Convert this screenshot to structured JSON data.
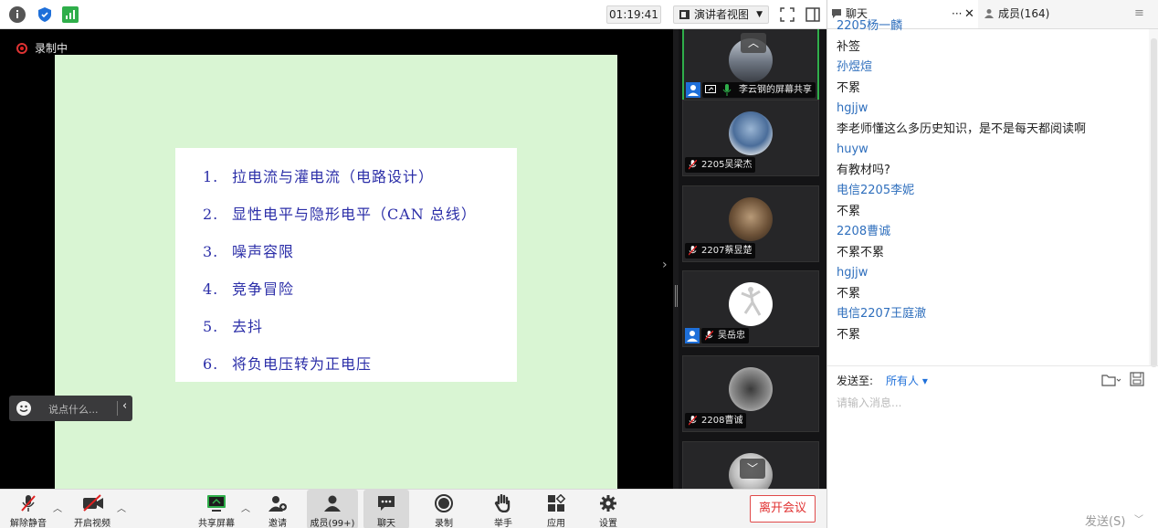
{
  "topbar": {
    "timer": "01:19:41",
    "view_label": "演讲者视图"
  },
  "stage": {
    "recording_label": "录制中",
    "slide_items": [
      {
        "num": "1.",
        "text": "拉电流与灌电流（电路设计）"
      },
      {
        "num": "2.",
        "text": "显性电平与隐形电平（CAN 总线）"
      },
      {
        "num": "3.",
        "text": "噪声容限"
      },
      {
        "num": "4.",
        "text": "竞争冒险"
      },
      {
        "num": "5.",
        "text": "去抖"
      },
      {
        "num": "6.",
        "text": "将负电压转为正电压"
      }
    ],
    "chat_placeholder": "说点什么..."
  },
  "gallery": {
    "tiles": [
      {
        "label": "李云钢的屏幕共享",
        "host": true
      },
      {
        "label": "2205吴梁杰",
        "host": false
      },
      {
        "label": "2207蔡昱楚",
        "host": false
      },
      {
        "label": "吴岳忠",
        "host": true
      },
      {
        "label": "2208曹诚",
        "host": false
      }
    ]
  },
  "toolbar": {
    "unmute": "解除静音",
    "start_video": "开启视频",
    "share_screen": "共享屏幕",
    "invite": "邀请",
    "members": "成员(99+)",
    "chat": "聊天",
    "record": "录制",
    "raise_hand": "举手",
    "apps": "应用",
    "settings": "设置",
    "leave": "离开会议"
  },
  "panel": {
    "tab_chat": "聊天",
    "tab_members": "成员(164)",
    "messages": [
      {
        "type": "name",
        "text": "2205杨一麟"
      },
      {
        "type": "text",
        "text": "补签"
      },
      {
        "type": "name",
        "text": "孙煜煊"
      },
      {
        "type": "text",
        "text": "不累"
      },
      {
        "type": "name",
        "text": "hgjjw"
      },
      {
        "type": "text",
        "text": "李老师懂这么多历史知识，是不是每天都阅读啊"
      },
      {
        "type": "name",
        "text": "huyw"
      },
      {
        "type": "text",
        "text": "有教材吗?"
      },
      {
        "type": "name",
        "text": "电信2205李妮"
      },
      {
        "type": "text",
        "text": "不累"
      },
      {
        "type": "name",
        "text": "2208曹诚"
      },
      {
        "type": "text",
        "text": "不累不累"
      },
      {
        "type": "name",
        "text": "hgjjw"
      },
      {
        "type": "text",
        "text": "不累"
      },
      {
        "type": "name",
        "text": "电信2207王庭澈"
      },
      {
        "type": "text",
        "text": "不累"
      }
    ],
    "send_to_label": "发送至:",
    "send_to_value": "所有人 ▾",
    "input_placeholder": "请输入消息...",
    "send_button": "发送(S)"
  },
  "colors": {
    "accent_blue": "#1e6fd9",
    "record_red": "#e02020",
    "slide_bg": "#d9f5d3",
    "slide_text": "#2b2ea8",
    "leave_red": "#e03030"
  }
}
